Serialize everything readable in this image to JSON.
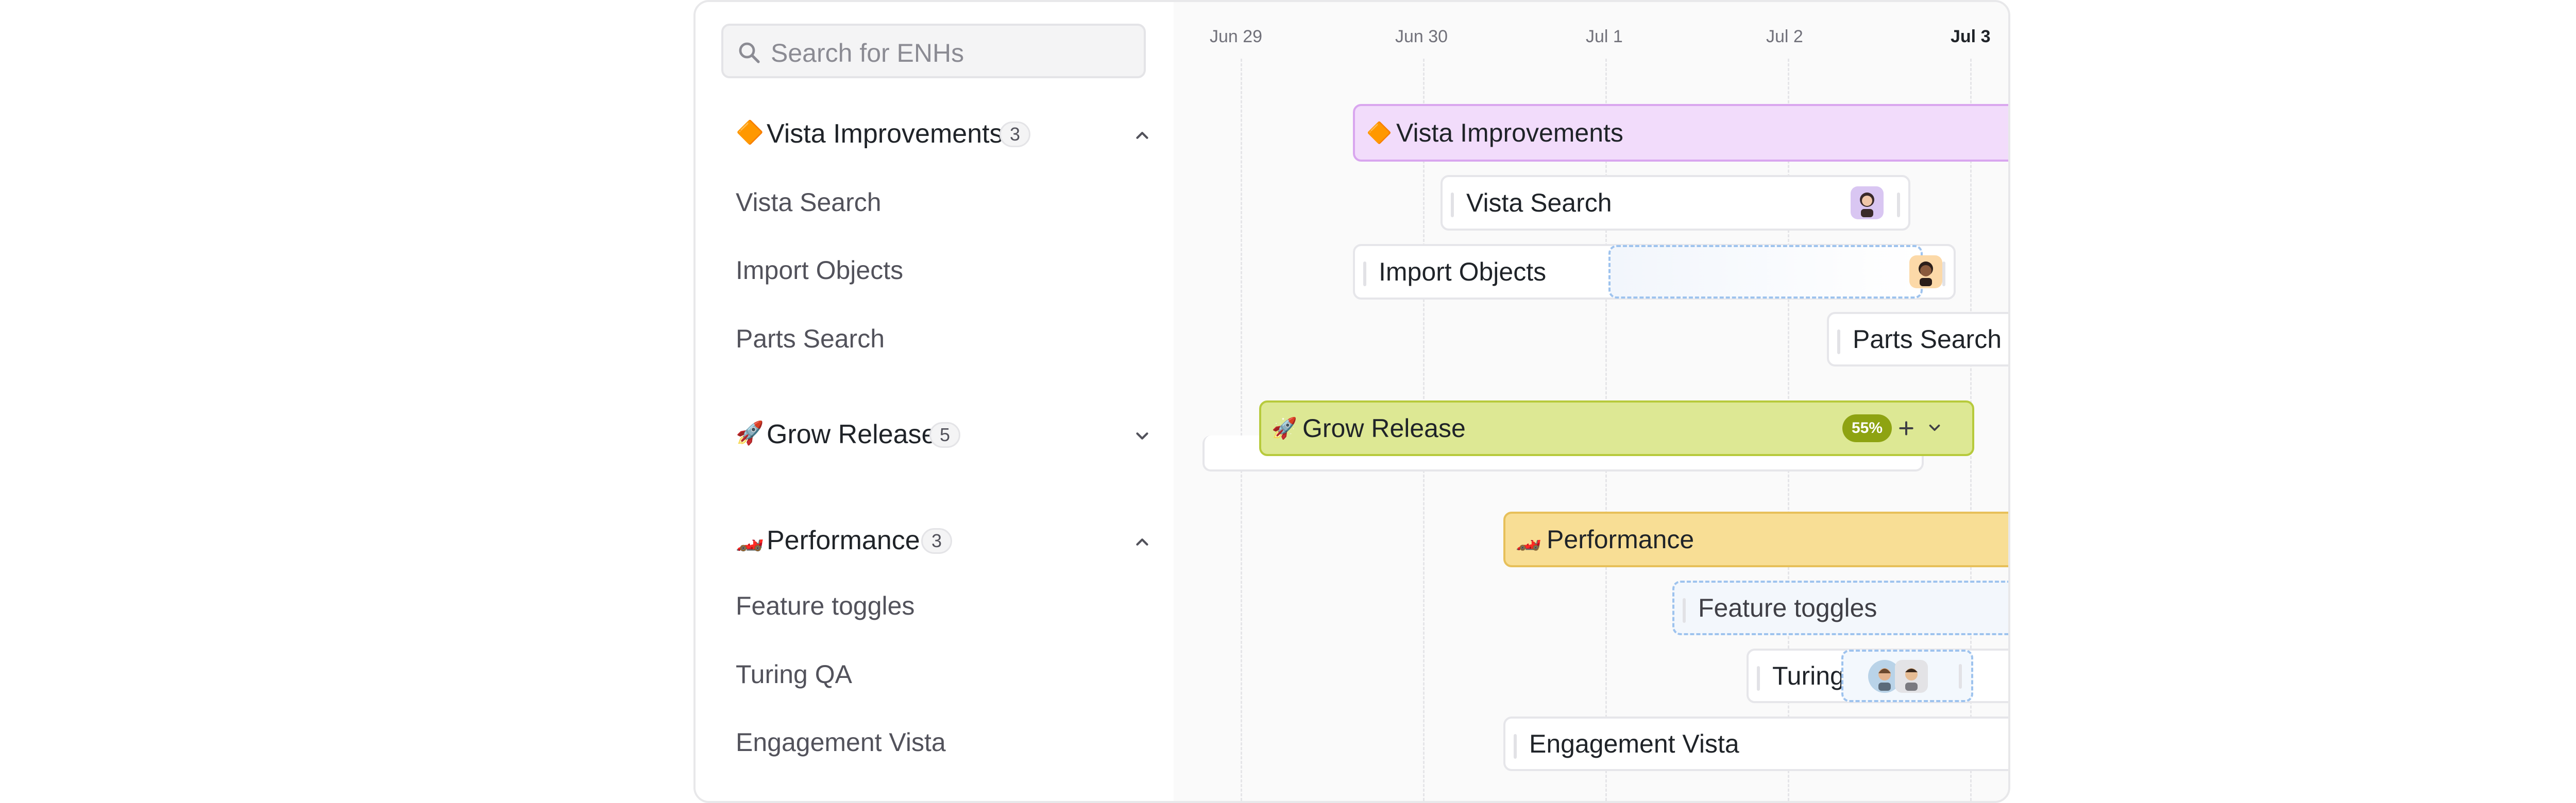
{
  "sidebar": {
    "search": {
      "placeholder": "Search for ENHs"
    },
    "groups": [
      {
        "icon": "diamond-icon",
        "emoji": "🔶",
        "label": "Vista Improvements",
        "count": "3",
        "expanded": true,
        "items": [
          "Vista Search",
          "Import Objects",
          "Parts Search"
        ]
      },
      {
        "icon": "rocket-icon",
        "emoji": "🚀",
        "label": "Grow Release",
        "count": "5",
        "expanded": false,
        "items": []
      },
      {
        "icon": "racecar-icon",
        "emoji": "🏎️",
        "label": "Performance",
        "count": "3",
        "expanded": true,
        "items": [
          "Feature toggles",
          "Turing QA",
          "Engagement Vista"
        ]
      }
    ]
  },
  "timeline": {
    "dates": [
      "Jun 29",
      "Jun 30",
      "Jul 1",
      "Jul 2",
      "Jul 3"
    ],
    "bars": {
      "vista_improvements": {
        "emoji": "🔶",
        "label": "Vista Improvements"
      },
      "vista_search": {
        "label": "Vista Search"
      },
      "import_objects": {
        "label": "Import Objects"
      },
      "parts_search": {
        "label": "Parts Search"
      },
      "grow_release": {
        "emoji": "🚀",
        "label": "Grow Release",
        "progress": "55%"
      },
      "performance": {
        "emoji": "🏎️",
        "label": "Performance"
      },
      "feature_toggles": {
        "label": "Feature toggles"
      },
      "turing_qa": {
        "label": "Turing QA"
      },
      "engagement_vista": {
        "label": "Engagement Vista"
      }
    }
  },
  "colors": {
    "vista_group": "#f2dcfb",
    "grow_group": "#dde894",
    "performance_group": "#f8de95",
    "progress_badge": "#8ea312",
    "dashed_border": "#9ec3ee"
  }
}
